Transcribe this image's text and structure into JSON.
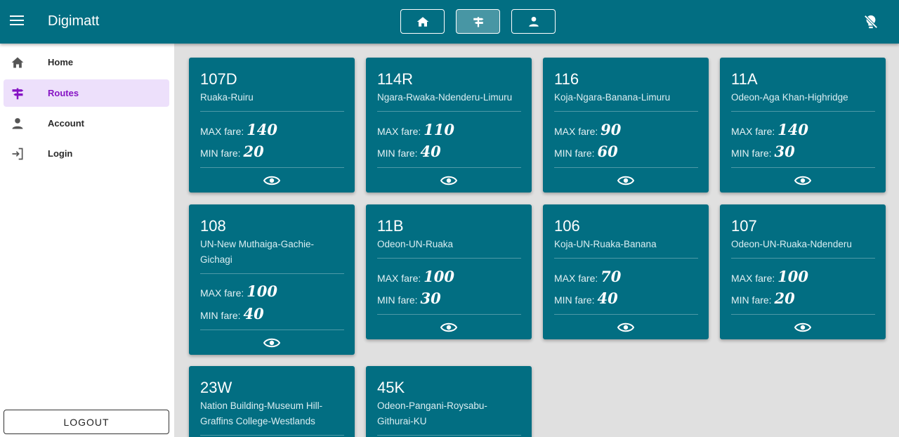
{
  "app": {
    "title": "Digimatt"
  },
  "topnav": [
    {
      "icon": "home-icon"
    },
    {
      "icon": "signpost-icon"
    },
    {
      "icon": "person-icon"
    }
  ],
  "sidebar": {
    "items": [
      {
        "label": "Home",
        "icon": "home-icon"
      },
      {
        "label": "Routes",
        "icon": "signpost-icon"
      },
      {
        "label": "Account",
        "icon": "person-icon"
      },
      {
        "label": "Login",
        "icon": "login-icon"
      }
    ],
    "logout_label": "LOGOUT"
  },
  "fare_labels": {
    "max": "MAX fare:",
    "min": "MIN fare:"
  },
  "routes": [
    {
      "code": "107D",
      "route": "Ruaka-Ruiru",
      "max": "140",
      "min": "20"
    },
    {
      "code": "114R",
      "route": "Ngara-Rwaka-Ndenderu-Limuru",
      "max": "110",
      "min": "40"
    },
    {
      "code": "116",
      "route": "Koja-Ngara-Banana-Limuru",
      "max": "90",
      "min": "60"
    },
    {
      "code": "11A",
      "route": "Odeon-Aga Khan-Highridge",
      "max": "140",
      "min": "30"
    },
    {
      "code": "108",
      "route": "UN-New Muthaiga-Gachie-Gichagi",
      "max": "100",
      "min": "40"
    },
    {
      "code": "11B",
      "route": "Odeon-UN-Ruaka",
      "max": "100",
      "min": "30"
    },
    {
      "code": "106",
      "route": "Koja-UN-Ruaka-Banana",
      "max": "70",
      "min": "40"
    },
    {
      "code": "107",
      "route": "Odeon-UN-Ruaka-Ndenderu",
      "max": "100",
      "min": "20"
    },
    {
      "code": "23W",
      "route": "Nation Building-Museum Hill-Graffins College-Westlands"
    },
    {
      "code": "45K",
      "route": "Odeon-Pangani-Roysabu-Githurai-KU"
    }
  ],
  "colors": {
    "primary": "#026e82",
    "sidebar_active_bg": "#ede0fb",
    "sidebar_active_text": "#8614c4"
  }
}
